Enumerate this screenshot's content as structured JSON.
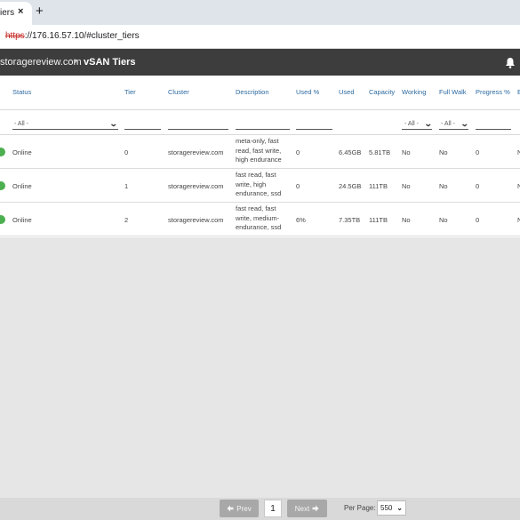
{
  "browser": {
    "tab_title": "iers",
    "tab_close": "×",
    "new_tab": "+",
    "url_scheme": "https",
    "url_rest": "://176.16.57.10/#cluster_tiers"
  },
  "header": {
    "site": "storagereview.com",
    "separator": "›",
    "page": "vSAN Tiers",
    "icon": "bell-icon"
  },
  "table": {
    "columns": [
      "Status",
      "Tier",
      "Cluster",
      "Description",
      "Used %",
      "Used",
      "Capacity",
      "Working",
      "Full Walk",
      "Progress %",
      "E"
    ],
    "filters": {
      "status": "- All -",
      "working": "- All -",
      "full_walk": "- All -"
    },
    "rows": [
      {
        "status": "Online",
        "tier": "0",
        "cluster": "storagereview.com",
        "description": "meta-only, fast read, fast write, high endurance",
        "used_pct": "0",
        "used": "6.45GB",
        "capacity": "5.81TB",
        "working": "No",
        "full_walk": "No",
        "progress": "0",
        "extra": "N"
      },
      {
        "status": "Online",
        "tier": "1",
        "cluster": "storagereview.com",
        "description": "fast read, fast write, high endurance, ssd",
        "used_pct": "0",
        "used": "24.5GB",
        "capacity": "111TB",
        "working": "No",
        "full_walk": "No",
        "progress": "0",
        "extra": "N"
      },
      {
        "status": "Online",
        "tier": "2",
        "cluster": "storagereview.com",
        "description": "fast read, fast write, medium-endurance, ssd",
        "used_pct": "6%",
        "used": "7.35TB",
        "capacity": "111TB",
        "working": "No",
        "full_walk": "No",
        "progress": "0",
        "extra": "N"
      }
    ],
    "status_color": "#4caf50"
  },
  "pager": {
    "prev": "Prev",
    "page": "1",
    "next": "Next",
    "per_page_label": "Per Page:",
    "per_page_value": "550"
  }
}
